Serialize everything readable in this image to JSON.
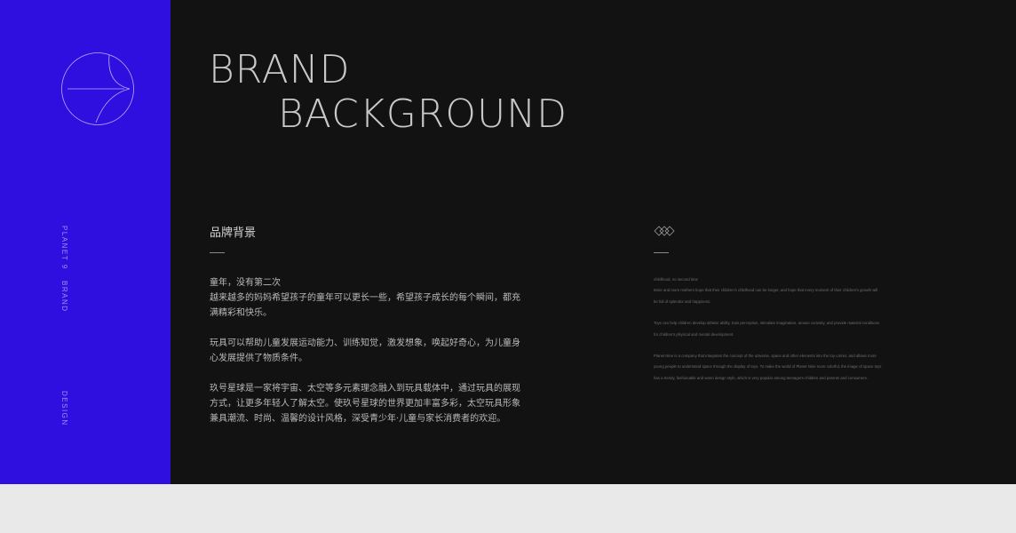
{
  "sidebar": {
    "labels": [
      "PLANET 9",
      "BRAND",
      "DESIGN"
    ],
    "icon": "circle-arrow-logo-icon"
  },
  "header": {
    "line1": "BRAND",
    "line2": "BACKGROUND"
  },
  "chinese": {
    "title": "品牌背景",
    "paragraphs": [
      "童年，没有第二次",
      "越来越多的妈妈希望孩子的童年可以更长一些，希望孩子成长的每个瞬间，都充满精彩和快乐。",
      "玩具可以帮助儿童发展运动能力、训练知觉，激发想象，唤起好奇心，为儿童身心发展提供了物质条件。",
      "玖号星球是一家将宇宙、太空等多元素理念融入到玩具载体中，通过玩具的展现方式，让更多年轻人了解太空。使玖号星球的世界更加丰富多彩，太空玩具形象兼具潮流、时尚、温馨的设计风格，深受青少年·儿童与家长消费者的欢迎。"
    ]
  },
  "english": {
    "icon": "diamond-ornament-icon",
    "paragraphs": [
      "childhood, no second time",
      "More and more mothers hope that their children's childhood can be longer, and hope that every moment of their children's growth will be full of splendor and happiness.",
      "Toys can help children develop athletic ability, train perception, stimulate imagination, arouse curiosity, and provide material conditions for children's physical and mental development.",
      "Planet Nine is a company that integrates the concept of the universe, space and other elements into the toy carrier, and allows more young people to understand space through the display of toys. To make the world of Planet Nine more colorful, the image of space toys has a trendy, fashionable and warm design style, which is very popular among teenagers·children and parents and consumers."
    ]
  },
  "colors": {
    "sidebar": "#2e0fe0",
    "canvas": "#121212",
    "footer": "#e9e9e9"
  }
}
